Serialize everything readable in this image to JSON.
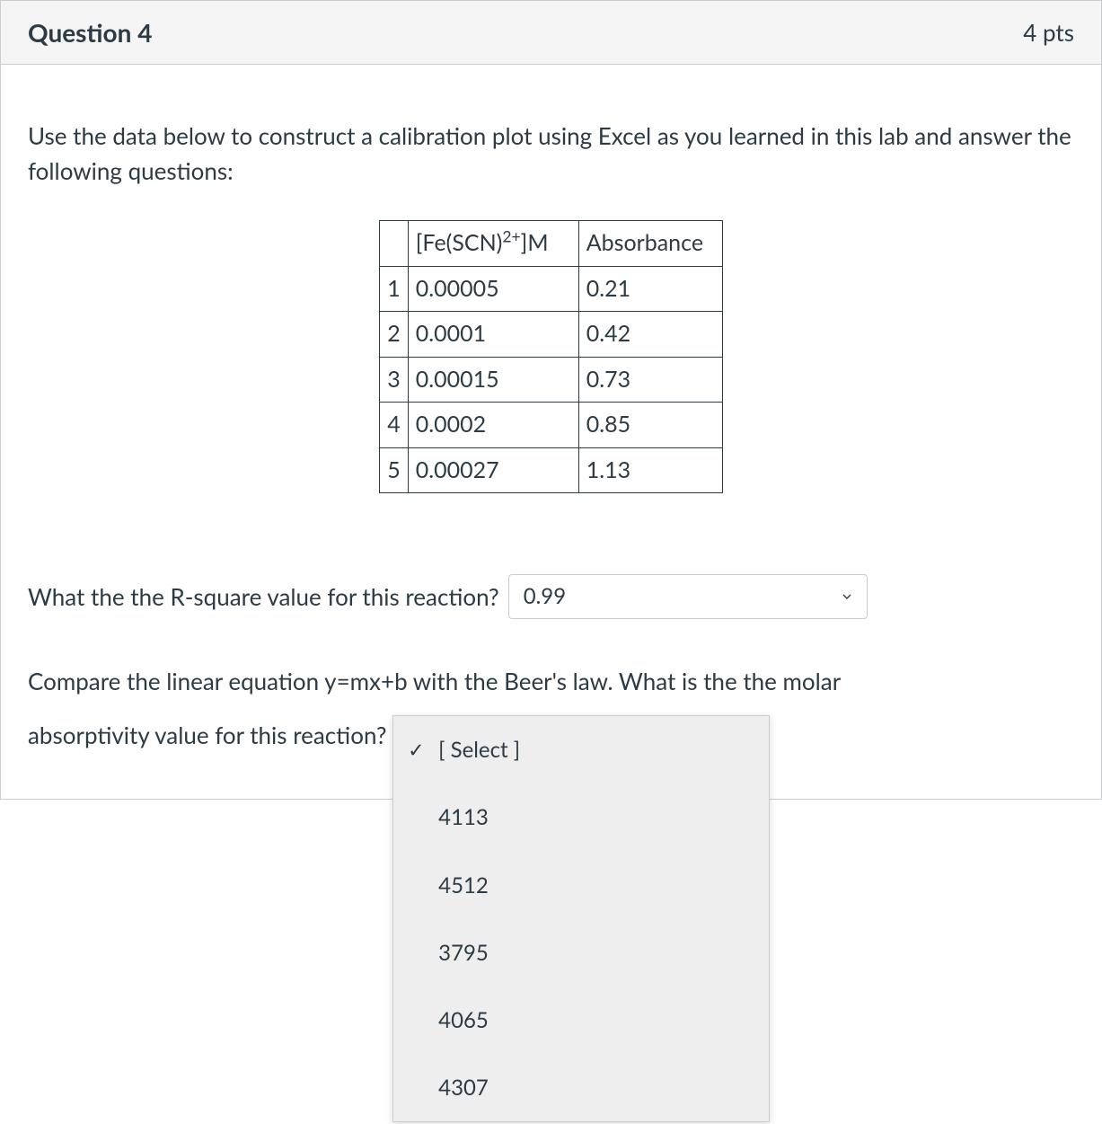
{
  "header": {
    "title": "Question 4",
    "points": "4 pts"
  },
  "instructions": "Use the data below to construct a calibration plot using Excel as you learned in this lab and answer the following questions:",
  "table": {
    "headers": {
      "index": "",
      "concentration_prefix": "[Fe(SCN)",
      "concentration_sup": "2+",
      "concentration_suffix": "]M",
      "absorbance": "Absorbance"
    },
    "rows": [
      {
        "index": "1",
        "concentration": "0.00005",
        "absorbance": "0.21"
      },
      {
        "index": "2",
        "concentration": "0.0001",
        "absorbance": "0.42"
      },
      {
        "index": "3",
        "concentration": "0.00015",
        "absorbance": "0.73"
      },
      {
        "index": "4",
        "concentration": "0.0002",
        "absorbance": "0.85"
      },
      {
        "index": "5",
        "concentration": "0.00027",
        "absorbance": "1.13"
      }
    ]
  },
  "q1": {
    "prompt": "What the the R-square value for this reaction?",
    "selected": "0.99"
  },
  "q2": {
    "prompt_line1": "Compare the linear equation y=mx+b with the Beer's law. What is the the molar",
    "prompt_line2": "absorptivity value for this reaction?",
    "placeholder": "[ Select ]",
    "options": [
      "4113",
      "4512",
      "3795",
      "4065",
      "4307"
    ]
  },
  "chart_data": {
    "type": "table",
    "title": "Calibration data: [Fe(SCN)2+] concentration vs Absorbance",
    "xlabel": "[Fe(SCN)2+] M",
    "ylabel": "Absorbance",
    "series": [
      {
        "name": "Absorbance",
        "x": [
          5e-05,
          0.0001,
          0.00015,
          0.0002,
          0.00027
        ],
        "y": [
          0.21,
          0.42,
          0.73,
          0.85,
          1.13
        ]
      }
    ]
  }
}
